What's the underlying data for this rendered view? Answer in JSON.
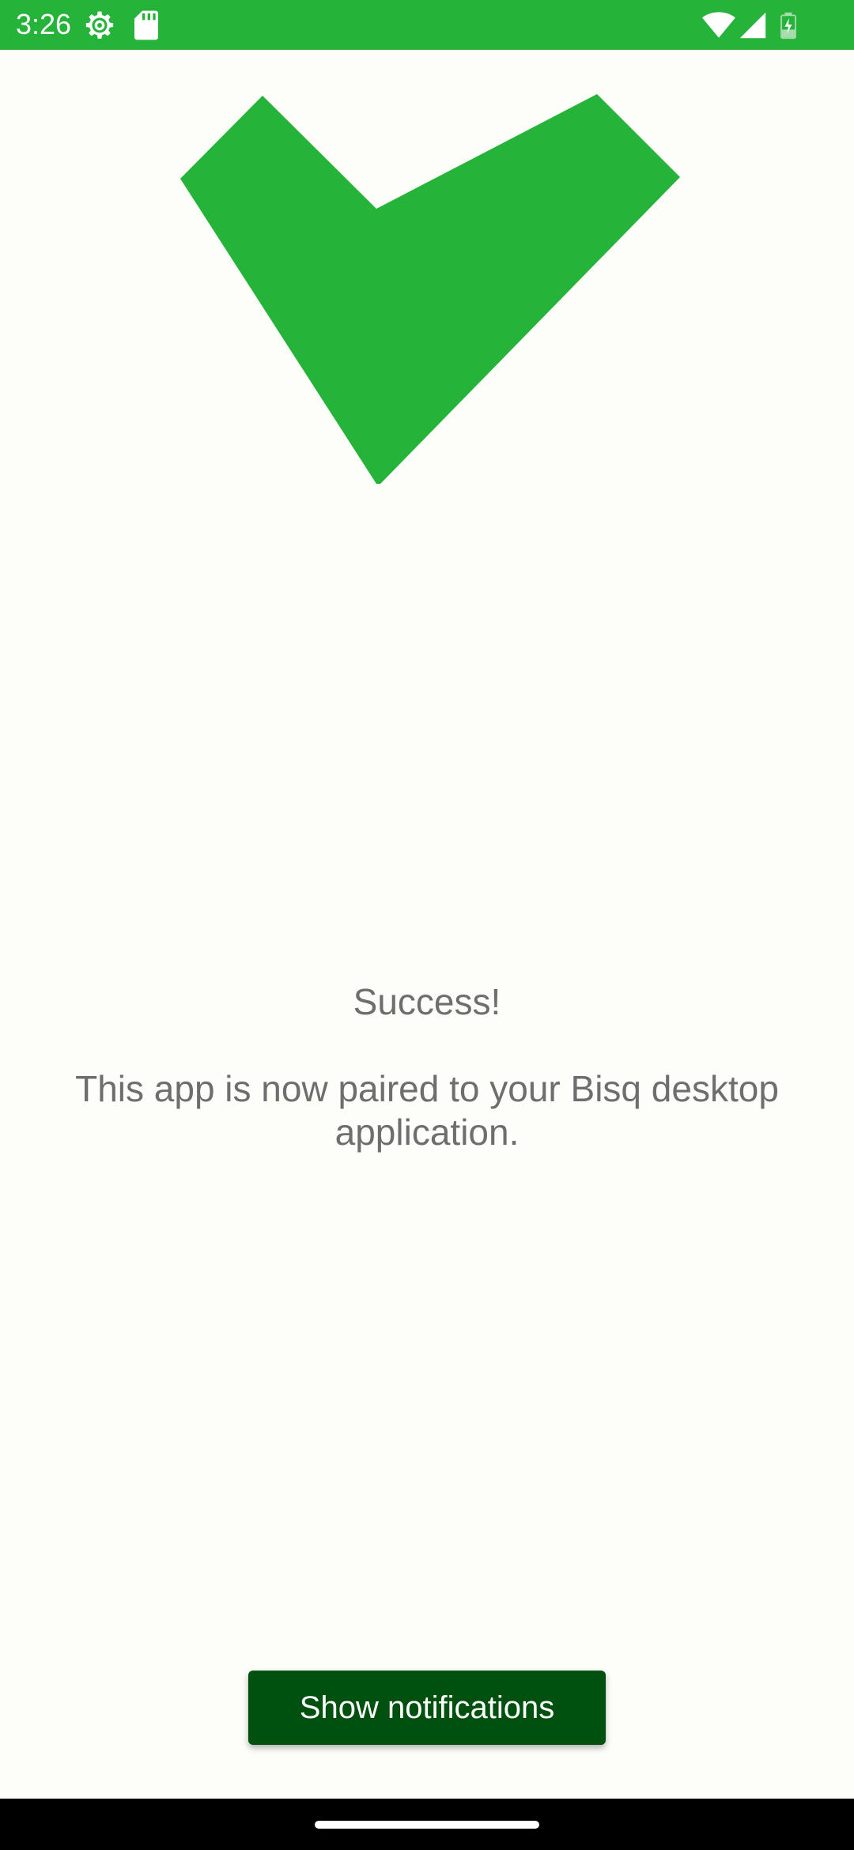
{
  "status_bar": {
    "time": "3:26",
    "background_color": "#26b33a",
    "icons": [
      "settings-gear-icon",
      "sd-card-icon",
      "wifi-icon",
      "signal-icon",
      "battery-charging-icon"
    ]
  },
  "main": {
    "success_icon": "check-mark-icon",
    "success_color": "#26b33a",
    "title": "Success!",
    "body": "This app is now paired to your Bisq desktop application."
  },
  "actions": {
    "show_notifications_label": "Show notifications",
    "button_color": "#00500f"
  },
  "navigation": {
    "gesture_handle": "home-gesture-handle"
  }
}
